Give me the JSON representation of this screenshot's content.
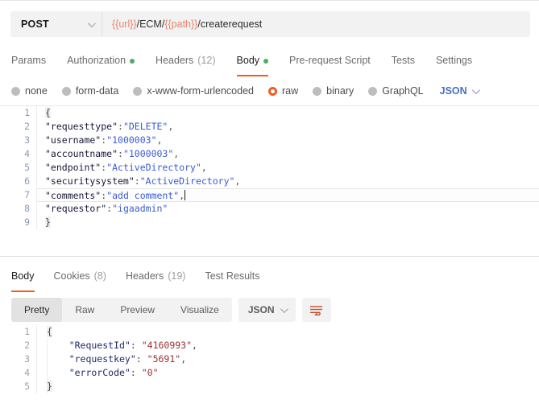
{
  "request_bar": {
    "method": "POST",
    "method_icon": "chevron-down-icon",
    "url_parts": [
      {
        "text": "{{url}}",
        "variable": true
      },
      {
        "text": "/ECM/",
        "variable": false
      },
      {
        "text": "{{path}}",
        "variable": false,
        "variable_style": true
      },
      {
        "text": "/createrequest",
        "variable": false
      }
    ],
    "url_full": "{{url}}/ECM/{{path}}/createrequest"
  },
  "request_tabs": [
    {
      "label": "Params",
      "active": false,
      "dot": false,
      "count": ""
    },
    {
      "label": "Authorization",
      "active": false,
      "dot": true,
      "count": ""
    },
    {
      "label": "Headers",
      "active": false,
      "dot": false,
      "count": "(12)"
    },
    {
      "label": "Body",
      "active": true,
      "dot": true,
      "count": ""
    },
    {
      "label": "Pre-request Script",
      "active": false,
      "dot": false,
      "count": ""
    },
    {
      "label": "Tests",
      "active": false,
      "dot": false,
      "count": ""
    },
    {
      "label": "Settings",
      "active": false,
      "dot": false,
      "count": ""
    }
  ],
  "body_types": [
    {
      "label": "none",
      "selected": false
    },
    {
      "label": "form-data",
      "selected": false
    },
    {
      "label": "x-www-form-urlencoded",
      "selected": false
    },
    {
      "label": "raw",
      "selected": true
    },
    {
      "label": "binary",
      "selected": false
    },
    {
      "label": "GraphQL",
      "selected": false
    }
  ],
  "body_format": {
    "label": "JSON",
    "icon": "chevron-down-icon"
  },
  "request_body": {
    "language": "json",
    "active_line": 7,
    "cursor_line": 7,
    "lines": [
      {
        "n": "1",
        "tokens": [
          {
            "t": "{",
            "c": "brace"
          }
        ]
      },
      {
        "n": "2",
        "tokens": [
          {
            "t": "\"requesttype\"",
            "c": "k"
          },
          {
            "t": ":",
            "c": "p"
          },
          {
            "t": "\"DELETE\"",
            "c": "s"
          },
          {
            "t": ",",
            "c": "p"
          }
        ]
      },
      {
        "n": "3",
        "tokens": [
          {
            "t": "\"username\"",
            "c": "k"
          },
          {
            "t": ":",
            "c": "p"
          },
          {
            "t": "\"1000003\"",
            "c": "s"
          },
          {
            "t": ",",
            "c": "p"
          }
        ]
      },
      {
        "n": "4",
        "tokens": [
          {
            "t": "\"accountname\"",
            "c": "k"
          },
          {
            "t": ":",
            "c": "p"
          },
          {
            "t": "\"1000003\"",
            "c": "s"
          },
          {
            "t": ",",
            "c": "p"
          }
        ]
      },
      {
        "n": "5",
        "tokens": [
          {
            "t": "\"endpoint\"",
            "c": "k"
          },
          {
            "t": ":",
            "c": "p"
          },
          {
            "t": "\"ActiveDirectory\"",
            "c": "s"
          },
          {
            "t": ",",
            "c": "p"
          }
        ]
      },
      {
        "n": "6",
        "tokens": [
          {
            "t": "\"securitysystem\"",
            "c": "k"
          },
          {
            "t": ":",
            "c": "p"
          },
          {
            "t": "\"ActiveDirectory\"",
            "c": "s"
          },
          {
            "t": ",",
            "c": "p"
          }
        ]
      },
      {
        "n": "7",
        "tokens": [
          {
            "t": "\"comments\"",
            "c": "k"
          },
          {
            "t": ":",
            "c": "p"
          },
          {
            "t": "\"add comment\"",
            "c": "s"
          },
          {
            "t": ",",
            "c": "p"
          }
        ]
      },
      {
        "n": "8",
        "tokens": [
          {
            "t": "\"requestor\"",
            "c": "k"
          },
          {
            "t": ":",
            "c": "p"
          },
          {
            "t": "\"igaadmin\"",
            "c": "s"
          }
        ]
      },
      {
        "n": "9",
        "tokens": [
          {
            "t": "}",
            "c": "brace"
          }
        ]
      }
    ],
    "raw_text": "{\n\"requesttype\":\"DELETE\",\n\"username\":\"1000003\",\n\"accountname\":\"1000003\",\n\"endpoint\":\"ActiveDirectory\",\n\"securitysystem\":\"ActiveDirectory\",\n\"comments\":\"add comment\",\n\"requestor\":\"igaadmin\"\n}"
  },
  "response_tabs": [
    {
      "label": "Body",
      "active": true,
      "count": ""
    },
    {
      "label": "Cookies",
      "active": false,
      "count": "(8)"
    },
    {
      "label": "Headers",
      "active": false,
      "count": "(19)"
    },
    {
      "label": "Test Results",
      "active": false,
      "count": ""
    }
  ],
  "response_view_modes": [
    {
      "label": "Pretty",
      "active": true
    },
    {
      "label": "Raw",
      "active": false
    },
    {
      "label": "Preview",
      "active": false
    },
    {
      "label": "Visualize",
      "active": false
    }
  ],
  "response_format": {
    "label": "JSON",
    "icon": "chevron-down-icon"
  },
  "wrap_button": {
    "icon": "wrap-lines-icon"
  },
  "response_body": {
    "language": "json",
    "lines": [
      {
        "n": "1",
        "tokens": [
          {
            "t": "{",
            "c": "rb"
          }
        ]
      },
      {
        "n": "2",
        "tokens": [
          {
            "t": "    \"RequestId\"",
            "c": "rk"
          },
          {
            "t": ": ",
            "c": "rp"
          },
          {
            "t": "\"4160993\"",
            "c": "rv"
          },
          {
            "t": ",",
            "c": "rp"
          }
        ]
      },
      {
        "n": "3",
        "tokens": [
          {
            "t": "    \"requestkey\"",
            "c": "rk"
          },
          {
            "t": ": ",
            "c": "rp"
          },
          {
            "t": "\"5691\"",
            "c": "rv"
          },
          {
            "t": ",",
            "c": "rp"
          }
        ]
      },
      {
        "n": "4",
        "tokens": [
          {
            "t": "    \"errorCode\"",
            "c": "rk"
          },
          {
            "t": ": ",
            "c": "rp"
          },
          {
            "t": "\"0\"",
            "c": "rv"
          }
        ]
      },
      {
        "n": "5",
        "tokens": [
          {
            "t": "}",
            "c": "rb"
          }
        ]
      }
    ],
    "values": {
      "RequestId": "4160993",
      "requestkey": "5691",
      "errorCode": "0"
    }
  },
  "colors": {
    "accent_orange": "#ef5b25",
    "status_green": "#50ab64",
    "variable_red": "#e8836f",
    "json_blue": "#4a6fc4",
    "response_key": "#1f2a6b",
    "response_value": "#9c2f2f",
    "request_string": "#3b5bd4"
  }
}
